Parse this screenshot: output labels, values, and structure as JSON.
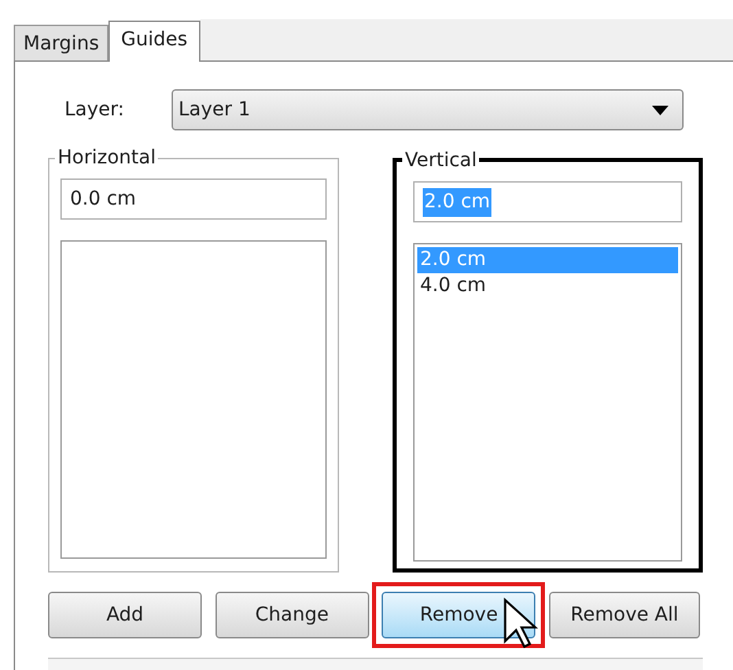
{
  "tabs": [
    {
      "label": "Margins",
      "selected": false
    },
    {
      "label": "Guides",
      "selected": true
    }
  ],
  "layer": {
    "label": "Layer:",
    "value": "Layer 1"
  },
  "groups": [
    {
      "title": "Horizontal",
      "highlighted": false,
      "field": {
        "value": "0.0 cm",
        "text_selected": false
      }
    },
    {
      "title": "Vertical",
      "highlighted": true,
      "field": {
        "value": "2.0 cm",
        "text_selected": true
      },
      "items": [
        {
          "label": "2.0 cm",
          "selected": true
        },
        {
          "label": "4.0 cm",
          "selected": false
        }
      ]
    }
  ],
  "buttons": [
    {
      "label": "Add",
      "hovered": false,
      "highlighted": false
    },
    {
      "label": "Change",
      "hovered": false,
      "highlighted": false
    },
    {
      "label": "Remove",
      "hovered": true,
      "highlighted": true
    },
    {
      "label": "Remove All",
      "hovered": false,
      "highlighted": false
    }
  ]
}
